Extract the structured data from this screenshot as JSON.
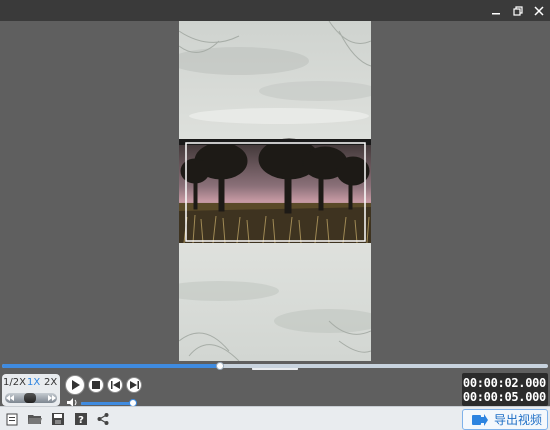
{
  "window": {
    "controls": [
      "minimize-icon",
      "restore-icon",
      "close-icon"
    ]
  },
  "preview": {
    "image_description_icon": "landscape-trees-icon",
    "selection_frame_visible": true
  },
  "playback": {
    "progress_fraction": 0.4,
    "speed_options": [
      "1/2X",
      "1X",
      "2X"
    ],
    "speed_selected": "1X",
    "volume_fraction": 1.0,
    "buttons": [
      "play-icon",
      "stop-icon",
      "previous-frame-icon",
      "next-frame-icon"
    ],
    "time_current": "00:00:02.000",
    "time_total": "00:00:05.000"
  },
  "toolbar": {
    "icons": [
      "new-project-icon",
      "open-folder-icon",
      "save-icon",
      "help-icon",
      "share-icon"
    ],
    "export_label": "导出视频"
  },
  "colors": {
    "accent": "#3f8be0",
    "titlebar": "#3a3a3a",
    "workspace": "#5f5f5f",
    "toolbar": "#e9ecef",
    "timecode_bg": "#2b2b2b"
  }
}
